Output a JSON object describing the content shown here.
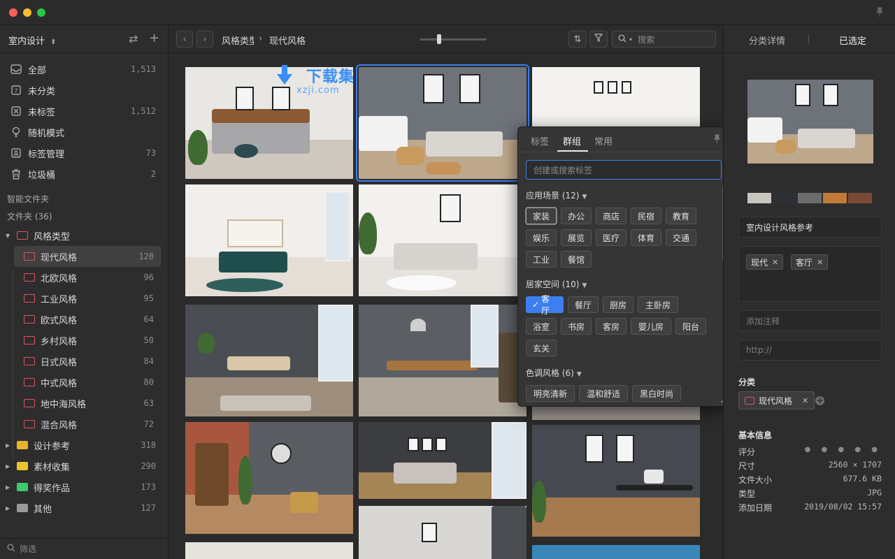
{
  "library": {
    "name": "室内设计",
    "chevron": "⌃⌄"
  },
  "sidebar": {
    "nav": [
      {
        "label": "全部",
        "count": "1,513",
        "icon": "inbox-icon"
      },
      {
        "label": "未分类",
        "count": "",
        "icon": "question-box-icon"
      },
      {
        "label": "未标签",
        "count": "1,512",
        "icon": "untagged-icon"
      },
      {
        "label": "随机模式",
        "count": "",
        "icon": "lightbulb-icon"
      },
      {
        "label": "标签管理",
        "count": "73",
        "icon": "tag-manage-icon"
      },
      {
        "label": "垃圾桶",
        "count": "2",
        "icon": "trash-icon"
      }
    ],
    "smart_folders_label": "智能文件夹",
    "folders_label": "文件夹 (36)",
    "folders": [
      {
        "label": "风格类型",
        "count": "",
        "color": "#e0525a"
      },
      {
        "label": "现代风格",
        "count": "128",
        "color": "#e0525a"
      },
      {
        "label": "北欧风格",
        "count": "96",
        "color": "#e0525a"
      },
      {
        "label": "工业风格",
        "count": "95",
        "color": "#e0525a"
      },
      {
        "label": "欧式风格",
        "count": "64",
        "color": "#e0525a"
      },
      {
        "label": "乡村风格",
        "count": "50",
        "color": "#e0525a"
      },
      {
        "label": "日式风格",
        "count": "84",
        "color": "#e0525a"
      },
      {
        "label": "中式风格",
        "count": "80",
        "color": "#e0525a"
      },
      {
        "label": "地中海风格",
        "count": "63",
        "color": "#e0525a"
      },
      {
        "label": "混合风格",
        "count": "72",
        "color": "#e0525a"
      },
      {
        "label": "设计参考",
        "count": "318",
        "color": "#e8b12e"
      },
      {
        "label": "素材收集",
        "count": "290",
        "color": "#e8c52e"
      },
      {
        "label": "得奖作品",
        "count": "173",
        "color": "#3ec86a"
      },
      {
        "label": "其他",
        "count": "127",
        "color": "#9a9a9a"
      }
    ],
    "filter_placeholder": "筛选"
  },
  "toolbar": {
    "breadcrumb_parent": "风格类型",
    "breadcrumb_current": "现代风格",
    "search_placeholder": "搜索"
  },
  "watermark": {
    "text": "下载集",
    "sub": "xzji.com"
  },
  "tag_popup": {
    "tabs": [
      "标签",
      "群组",
      "常用"
    ],
    "active_tab": "群组",
    "input_placeholder": "创建或搜索标签",
    "groups": [
      {
        "title": "应用场景 (12)",
        "tags": [
          "家装",
          "办公",
          "商店",
          "民宿",
          "教育",
          "娱乐",
          "展览",
          "医疗",
          "体育",
          "交通",
          "工业",
          "餐馆"
        ]
      },
      {
        "title": "居家空间 (10)",
        "tags": [
          "客厅",
          "餐厅",
          "厨房",
          "主卧房",
          "浴室",
          "书房",
          "客房",
          "婴儿房",
          "阳台",
          "玄关"
        ]
      },
      {
        "title": "色调风格 (6)",
        "tags": [
          "明亮清新",
          "温和舒适",
          "黑白时尚"
        ]
      }
    ],
    "checked_mark": "✓"
  },
  "right": {
    "tab_details": "分类详情",
    "tab_selected": "已选定",
    "swatches": [
      "#c9c5bf",
      "#2d3035",
      "#6c6c6e",
      "#c07a36",
      "#7a4a36"
    ],
    "title": "室内设计风格参考",
    "tags": [
      "现代",
      "客厅"
    ],
    "notes_placeholder": "添加注释",
    "url_placeholder": "http://",
    "category_label": "分类",
    "category": "现代风格",
    "info_label": "基本信息",
    "info": [
      {
        "k": "评分",
        "v": "● ● ● ● ●"
      },
      {
        "k": "尺寸",
        "v": "2560 × 1707"
      },
      {
        "k": "文件大小",
        "v": "677.6 KB"
      },
      {
        "k": "类型",
        "v": "JPG"
      },
      {
        "k": "添加日期",
        "v": "2019/08/02 15:57"
      }
    ]
  }
}
